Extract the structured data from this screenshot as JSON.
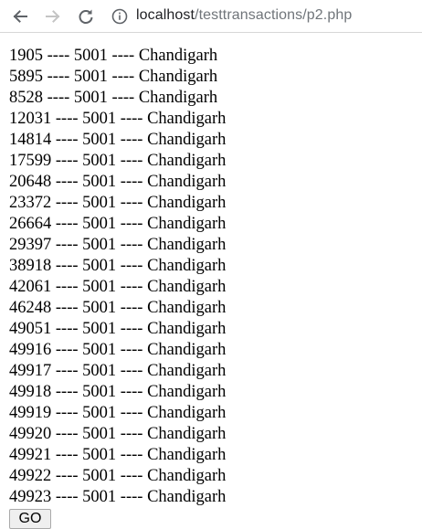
{
  "browser": {
    "url_host": "localhost",
    "url_path": "/testtransactions/p2.php",
    "icons": {
      "back": "arrow-left-icon",
      "forward": "arrow-right-icon",
      "reload": "reload-icon",
      "info": "info-icon"
    }
  },
  "records": [
    {
      "id": "1905",
      "code": "5001",
      "city": "Chandigarh"
    },
    {
      "id": "5895",
      "code": "5001",
      "city": "Chandigarh"
    },
    {
      "id": "8528",
      "code": "5001",
      "city": "Chandigarh"
    },
    {
      "id": "12031",
      "code": "5001",
      "city": "Chandigarh"
    },
    {
      "id": "14814",
      "code": "5001",
      "city": "Chandigarh"
    },
    {
      "id": "17599",
      "code": "5001",
      "city": "Chandigarh"
    },
    {
      "id": "20648",
      "code": "5001",
      "city": "Chandigarh"
    },
    {
      "id": "23372",
      "code": "5001",
      "city": "Chandigarh"
    },
    {
      "id": "26664",
      "code": "5001",
      "city": "Chandigarh"
    },
    {
      "id": "29397",
      "code": "5001",
      "city": "Chandigarh"
    },
    {
      "id": "38918",
      "code": "5001",
      "city": "Chandigarh"
    },
    {
      "id": "42061",
      "code": "5001",
      "city": "Chandigarh"
    },
    {
      "id": "46248",
      "code": "5001",
      "city": "Chandigarh"
    },
    {
      "id": "49051",
      "code": "5001",
      "city": "Chandigarh"
    },
    {
      "id": "49916",
      "code": "5001",
      "city": "Chandigarh"
    },
    {
      "id": "49917",
      "code": "5001",
      "city": "Chandigarh"
    },
    {
      "id": "49918",
      "code": "5001",
      "city": "Chandigarh"
    },
    {
      "id": "49919",
      "code": "5001",
      "city": "Chandigarh"
    },
    {
      "id": "49920",
      "code": "5001",
      "city": "Chandigarh"
    },
    {
      "id": "49921",
      "code": "5001",
      "city": "Chandigarh"
    },
    {
      "id": "49922",
      "code": "5001",
      "city": "Chandigarh"
    },
    {
      "id": "49923",
      "code": "5001",
      "city": "Chandigarh"
    }
  ],
  "separator": " ---- ",
  "go_button_label": "GO"
}
